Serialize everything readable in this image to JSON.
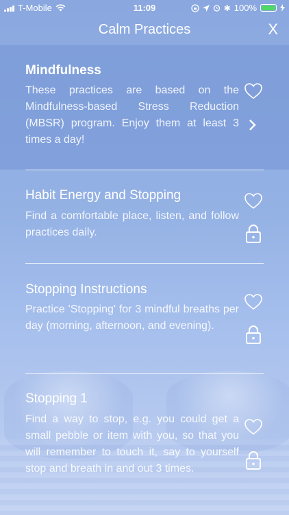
{
  "status_bar": {
    "carrier": "T-Mobile",
    "time": "11:09",
    "battery_percent": "100%",
    "battery_level": 1.0
  },
  "header": {
    "title": "Calm Practices",
    "close_label": "X"
  },
  "practices": [
    {
      "title": "Mindfulness",
      "description": "These practices are based on the Mindfulness-based Stress Reduction (MBSR) program. Enjoy them at least 3 times a day!",
      "locked": false,
      "trailing_icon": "chevron-right-icon"
    },
    {
      "title": "Habit Energy and Stopping",
      "description": "Find a comfortable place, listen, and follow practices daily.",
      "locked": true,
      "trailing_icon": "lock-icon"
    },
    {
      "title": "Stopping Instructions",
      "description": "Practice 'Stopping' for 3 mindful breaths per day (morning, afternoon, and evening).",
      "locked": true,
      "trailing_icon": "lock-icon"
    },
    {
      "title": "Stopping 1",
      "description": "Find a way to stop, e.g. you could get a small pebble or item with you, so that you will remember to touch it, say to yourself stop and breath in and out 3 times.",
      "locked": true,
      "trailing_icon": "lock-icon"
    }
  ],
  "colors": {
    "background_top": "#8aa8df",
    "background_bottom": "#c3d3f2",
    "text": "#ffffff",
    "battery": "#4cd964"
  }
}
